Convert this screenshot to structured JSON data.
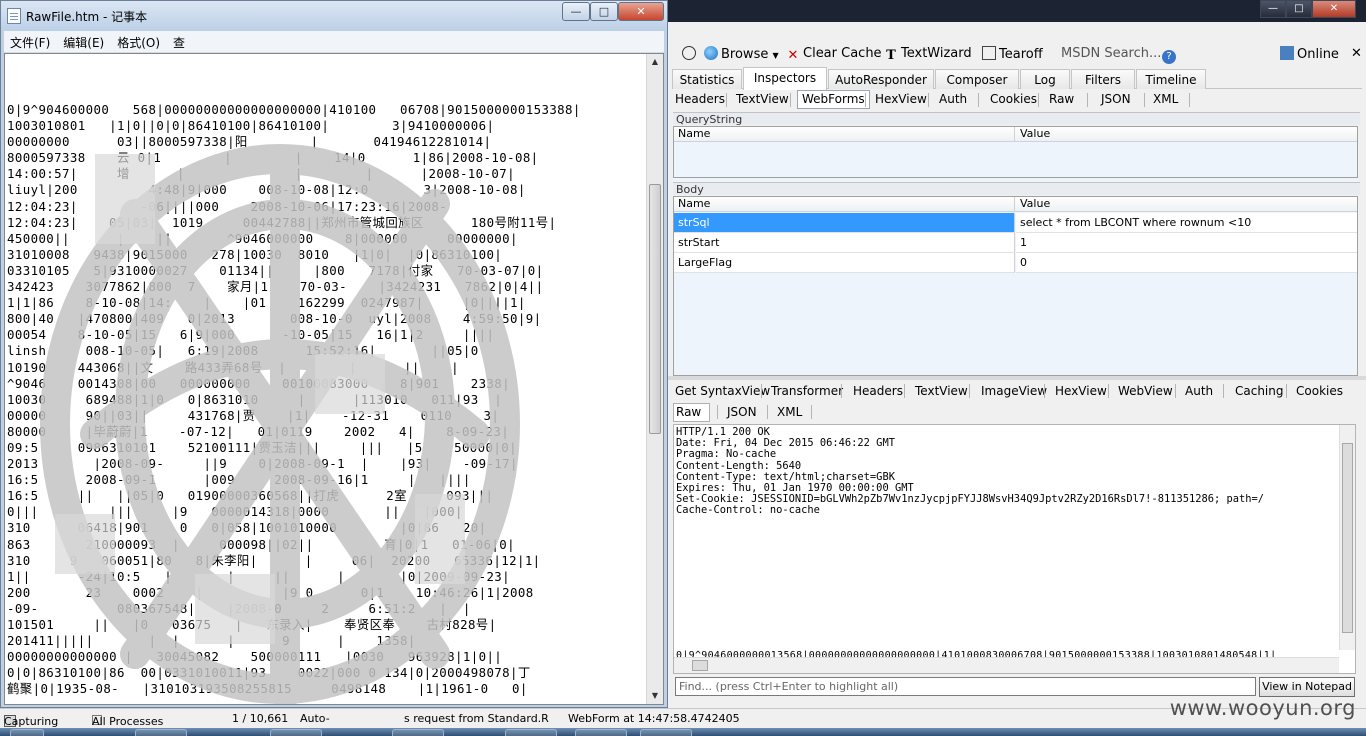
{
  "notepad": {
    "title": "RawFile.htm - 记事本",
    "menus": [
      "文件(F)",
      "编辑(E)",
      "格式(O)",
      "查"
    ],
    "lines": [
      "0|9^904600000   568|00000000000000000000|410100   06708|9015000000153388|",
      "1003010801   |1|0||0|0|86410100|86410100|        3|9410000006|",
      "00000000      03||8000597338|阳        |       04194612281014|",
      "8000597338    云 0|1        |        |    14|0      1|86|2008-10-08|",
      "14:00:57|     增      |              |        |      |2008-10-07|",
      "liuyl|200         4:48|9|000    008-10-08|12:0       3|2008-10-08|",
      "12:04:23|        -06||||000    2008-10-06|17:23:16|2008-",
      "12:04:23|    05|03|  1019     00442788||郑州市管城回族区      180号附11号|",
      "450000||      |    ||       ^9046000000    8|000000     00000000|",
      "31010008   9438|9015000   278|10030  8010   |1|0|  |0|86310100|",
      "03310105   5|9310000027    01134||     |800   7178|付家   70-03-07|0|",
      "342423    3077862|800  7    家月|1    70-03-    |3424231   7862|0|4||",
      "1|1|86    8-10-08|14:    |    |01    162299  0247987|     |0||||1|",
      "800|40   |470800|409   0|2013       008-10-0  uyl|2008    4:59:50|9|",
      "00054    8-10-05|15   6|9|000      -10-05|15   16|1|2     ||||",
      "linsh     008-10-05|   6:19|2008      15:52:16|       ||05|0",
      "10190    443068||文    路433弄68号  |        |      ||    |",
      "^9046    0014308|00   000000000    00100083000    8|901    2338|",
      "10030     689488|1|0   0|8631010     |      |113010   011|93  |",
      "00000     90||03||     431768|贾    |1|    -12-31    0110    3|",
      "80000     |毕蔚蔚|1    -07-12|   01|0119    2002   4|    8-09-23|",
      "09:5     0986310101    52100111|贾玉洁|||     |||   |5    50000|0|",
      "2013       |2008-09-     ||9    0|2008-09-1  |    |93|    -09-17|",
      "16:5      2008-09-1      |009     2008-09-16|1     |   ||||",
      "16:5     ||   ||05|0   01900000360568||打虎      2室     093|||",
      "0|||         |||     |9   0000014318|0000       ||   |000|",
      "310      06418|901    0   0|058|1001010000        |0|86   20|",
      "863       210000093  |     000098||02||         育|0|1   01-06|0|",
      "310     9   060051|80   8|朱李阳|      |     06|  20200   65336|12|1|",
      "1||      -24|10:5   |       |     ||      |       |0|2009-09-23|",
      "200       23    0002    |          |9 0      0|1    10:46:26|1|2008",
      "-09-          080367548|    |2008-0     2     6:51:2   |  |",
      "101501     ||   |0   03675   |   东录入|    奉贤区奉    古村828号|",
      "201411|||||       |  |      |      9      |    1358|",
      "00000000000000 |   30045082    500000111   |0030   963928|1|0||",
      "0|0|86310100|86  00|0331010011|93    0022|000 0 134|0|2000498078|丁",
      "鹤聚|0|1935-08-   |310103193508255815     0498148    |1|1961-0   0|"
    ]
  },
  "fiddler": {
    "toolbar": {
      "browse": "Browse",
      "clear_cache": "Clear Cache",
      "textwizard": "TextWizard",
      "tearoff": "Tearoff",
      "msdn_search": "MSDN Search...",
      "online": "Online"
    },
    "main_tabs": [
      "Statistics",
      "Inspectors",
      "AutoResponder",
      "Composer",
      "Log",
      "Filters",
      "Timeline"
    ],
    "request_tabs": [
      "Headers",
      "TextView",
      "WebForms",
      "HexView",
      "Auth",
      "Cookies",
      "Raw",
      "JSON",
      "XML"
    ],
    "querystring": {
      "section": "QueryString",
      "col_name": "Name",
      "col_value": "Value"
    },
    "body": {
      "section": "Body",
      "col_name": "Name",
      "col_value": "Value",
      "rows": [
        {
          "name": "strSql",
          "value": "select * from LBCONT where rownum <10"
        },
        {
          "name": "strStart",
          "value": "1"
        },
        {
          "name": "LargeFlag",
          "value": "0"
        }
      ]
    },
    "response_tabs": [
      "Get SyntaxView",
      "Transformer",
      "Headers",
      "TextView",
      "ImageView",
      "HexView",
      "WebView",
      "Auth",
      "Caching",
      "Cookies"
    ],
    "response_tabs2": [
      "Raw",
      "JSON",
      "XML"
    ],
    "response_headers": "HTTP/1.1 200 OK\nDate: Fri, 04 Dec 2015 06:46:22 GMT\nPragma: No-cache\nContent-Length: 5640\nContent-Type: text/html;charset=GBK\nExpires: Thu, 01 Jan 1970 00:00:00 GMT\nSet-Cookie: JSESSIONID=bGLVWh2pZb7Wv1nzJycpjpFYJJ8WsvH34Q9Jptv2RZy2D16RsDl7!-811351286; path=/\nCache-Control: no-cache",
    "response_body_line": "0|9^9046000000013568|00000000000000000000|4101000830006708|9015000000153388|1003010801480548|1|",
    "find_placeholder": "Find... (press Ctrl+Enter to highlight all)",
    "view_in_notepad": "View in Notepad"
  },
  "statusbar": {
    "capturing": "Capturing",
    "processes": "All Processes",
    "count": "1 / 10,661",
    "auto": "Auto-",
    "message": "s request from Standard.R",
    "webform": "WebForm at 14:47:58.4742405"
  },
  "watermark": "www.wooyun.org",
  "colors": {
    "selection": "#3399ff",
    "titlebar_dark": "#1c2433",
    "notepad_frame": "#bfd0e3"
  }
}
